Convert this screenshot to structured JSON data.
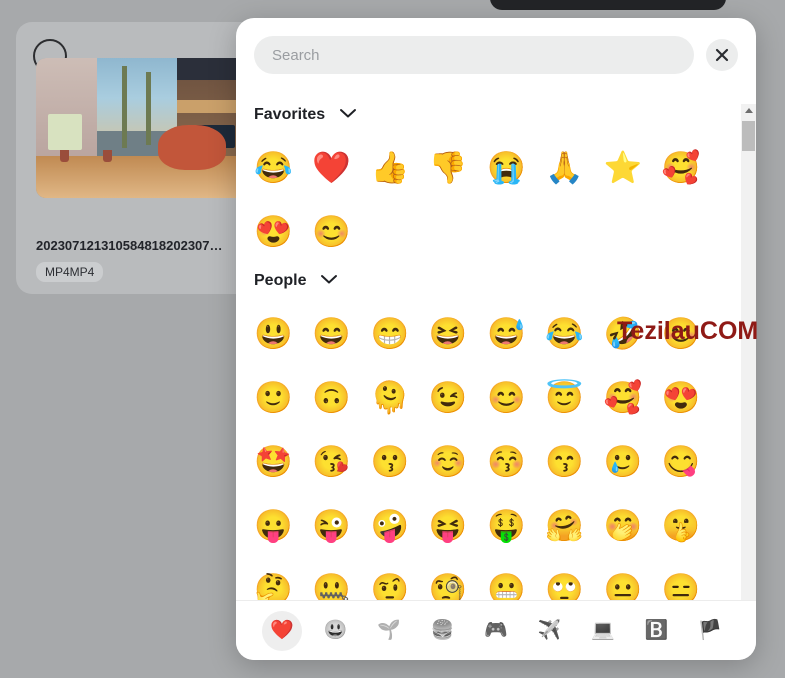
{
  "background": {
    "top_bar": "",
    "file_card": {
      "filename": "202307121310584818202307…",
      "format_badge": "MP4MP4",
      "select_checkbox": ""
    }
  },
  "picker": {
    "search": {
      "placeholder": "Search",
      "value": ""
    },
    "close_label": "✕",
    "groups": [
      {
        "title": "Favorites",
        "chevron": "⌄",
        "emojis": [
          "😂",
          "❤️",
          "👍",
          "👎",
          "😭",
          "🙏",
          "⭐",
          "🥰",
          "😍",
          "😊"
        ]
      },
      {
        "title": "People",
        "chevron": "⌄",
        "emojis": [
          "😃",
          "😄",
          "😁",
          "😆",
          "😅",
          "😂",
          "🤣",
          "😊",
          "🙂",
          "🙃",
          "🫠",
          "😉",
          "😊",
          "😇",
          "🥰",
          "😍",
          "🤩",
          "😘",
          "😗",
          "☺️",
          "😚",
          "😙",
          "🥲",
          "😋",
          "😛",
          "😜",
          "🤪",
          "😝",
          "🤑",
          "🤗",
          "🤭",
          "🤫",
          "🤔",
          "🤐",
          "🤨",
          "🧐",
          "😬",
          "🙄",
          "😐",
          "😑"
        ]
      }
    ],
    "scrollbar": {
      "up_arrow": "▲",
      "down_arrow": "▼"
    },
    "tabs": [
      {
        "name": "favorites",
        "icon": "❤️",
        "active": true
      },
      {
        "name": "smileys",
        "icon": "😃",
        "active": false
      },
      {
        "name": "nature",
        "icon": "🌱",
        "active": false
      },
      {
        "name": "food",
        "icon": "🍔",
        "active": false
      },
      {
        "name": "activity",
        "icon": "🎮",
        "active": false
      },
      {
        "name": "travel",
        "icon": "✈️",
        "active": false
      },
      {
        "name": "objects",
        "icon": "💻",
        "active": false
      },
      {
        "name": "symbols",
        "icon": "🅱️",
        "active": false
      },
      {
        "name": "flags",
        "icon": "🏴",
        "active": false
      }
    ]
  },
  "watermark": {
    "text": "TezilauCOM",
    "color": "#8f1a16"
  },
  "colors": {
    "page_background": "#a7a9ab",
    "panel_background": "#ffffff",
    "search_background": "#eceded",
    "card_background": "#b9bbbd",
    "top_bar": "#232427",
    "active_tab_background": "#eeeeee"
  }
}
